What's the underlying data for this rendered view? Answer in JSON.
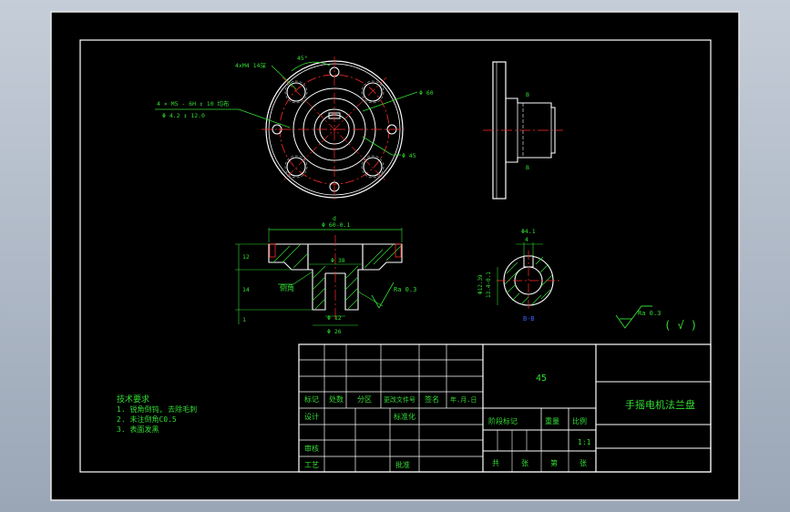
{
  "drawing": {
    "title": "手摇电机法兰盘",
    "material": "45",
    "scale": "1:1"
  },
  "annotations": {
    "hole_note": "4xM4 14深",
    "angle": "45°",
    "bolt_holes_line1": "4 × M5 - 6H ↕ 10 均布",
    "bolt_holes_line2": "Φ 4.2 ↕ 12.0",
    "dia_60": "Φ 60",
    "dia_45": "Φ 45",
    "sec_d_label": "d",
    "sec_dia_top": "Φ 60-0.1",
    "sec_dia_38": "Φ 38",
    "sec_dia_12": "Φ 12",
    "sec_dia_26": "Φ 26",
    "sec_h_12": "12",
    "sec_h_14": "14",
    "sec_h_1": "1",
    "sec_ra": "Ra 0.3",
    "sec_chamfer": "倒角",
    "key_top1": "Φ4.1",
    "key_top2": "4",
    "key_side1": "Φ12.39",
    "key_side2": "13.4-0.1",
    "key_section": "B-B",
    "ra_general": "Ra 0.3",
    "ra_paren": "( √ )",
    "right_b_top": "B",
    "right_b_bottom": "B"
  },
  "tech_requirements": {
    "title": "技术要求",
    "items": [
      "1. 锐角倒钝, 去除毛刺",
      "2. 未注倒角C0.5",
      "3. 表面发黑"
    ]
  },
  "title_block": {
    "hdr_biaoji": "标记",
    "hdr_chushu": "处数",
    "hdr_fenqu": "分区",
    "hdr_gengai": "更改文件号",
    "hdr_qianming": "签名",
    "hdr_date": "年.月.日",
    "sheji": "设计",
    "biaozhunhua": "标准化",
    "shenhe": "审核",
    "gongyi": "工艺",
    "pizhun": "批准",
    "jieduan": "阶段标记",
    "zhongliang": "重量",
    "bili": "比例",
    "gong": "共",
    "zhang": "张",
    "di": "第",
    "zhang2": "张"
  }
}
